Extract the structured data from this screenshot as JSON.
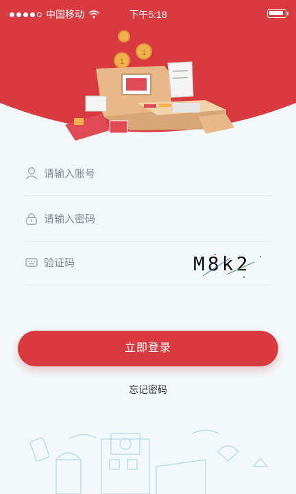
{
  "status_bar": {
    "carrier": "中国移动",
    "time": "下午5:18"
  },
  "form": {
    "account_placeholder": "请输入账号",
    "password_placeholder": "请输入密码",
    "captcha_placeholder": "验证码",
    "captcha_code": "M8k2"
  },
  "actions": {
    "login_label": "立即登录",
    "forgot_label": "忘记密码"
  },
  "colors": {
    "brand_red": "#d93a3f",
    "background": "#f3f8fa"
  }
}
